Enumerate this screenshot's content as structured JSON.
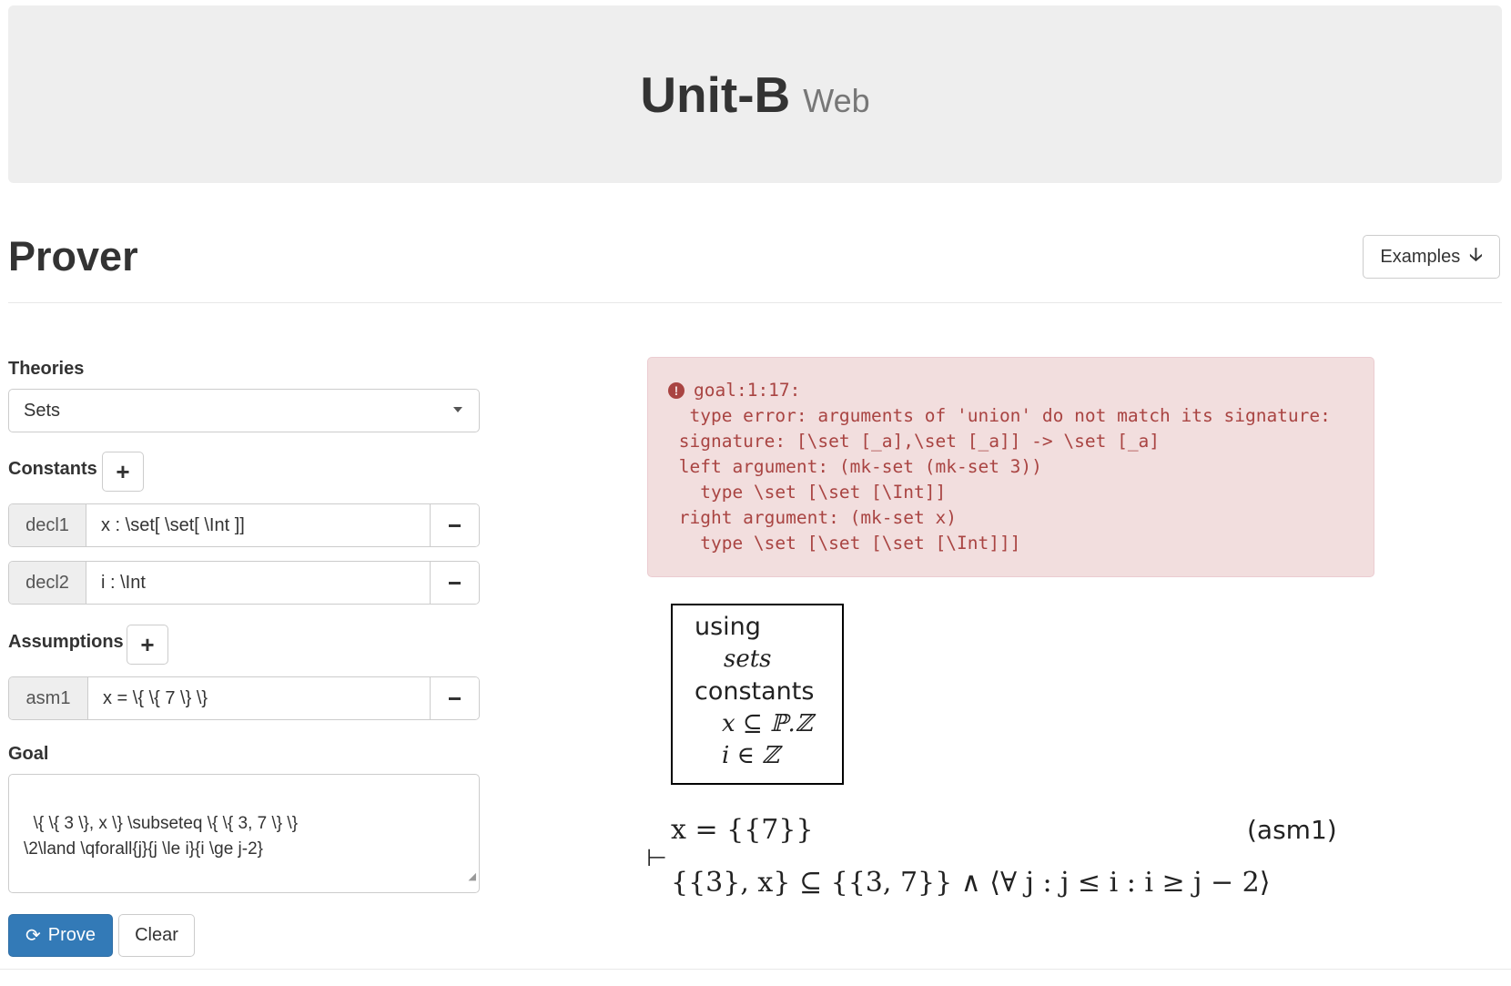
{
  "header": {
    "brand_main": "Unit-B",
    "brand_sub": "Web"
  },
  "page": {
    "title": "Prover",
    "examples_label": "Examples"
  },
  "form": {
    "theories_label": "Theories",
    "theory_selected": "Sets",
    "constants_label": "Constants",
    "constants": [
      {
        "name": "decl1",
        "value": "x : \\set[ \\set[ \\Int ]]"
      },
      {
        "name": "decl2",
        "value": "i : \\Int"
      }
    ],
    "assumptions_label": "Assumptions",
    "assumptions": [
      {
        "name": "asm1",
        "value": "x = \\{ \\{ 7 \\} \\}"
      }
    ],
    "goal_label": "Goal",
    "goal_text": "\\{ \\{ 3 \\}, x \\} \\subseteq \\{ \\{ 3, 7 \\} \\}\n\\2\\land \\qforall{j}{j \\le i}{i \\ge j-2}",
    "prove_label": "Prove",
    "clear_label": "Clear"
  },
  "error": {
    "lines": [
      "goal:1:17:",
      "  type error: arguments of 'union' do not match its signature:",
      " signature: [\\set [_a],\\set [_a]] -> \\set [_a]",
      " left argument: (mk-set (mk-set 3))",
      "   type \\set [\\set [\\Int]]",
      " right argument: (mk-set x)",
      "   type \\set [\\set [\\set [\\Int]]]"
    ]
  },
  "rendered": {
    "using_kw": "using",
    "theory_name": "sets",
    "constants_kw": "constants",
    "const1": "x ⊆ ℙ.ℤ",
    "const2": "i ∈ ℤ",
    "assumption_formula": "x = {{7}}",
    "assumption_tag": "(asm1)",
    "turnstile": "⊢",
    "goal_formula": "{{3}, x} ⊆ {{3, 7}}   ∧   ⟨∀ j : j ≤ i : i ≥ j − 2⟩"
  },
  "colors": {
    "jumbotron_bg": "#eeeeee",
    "primary": "#337ab7",
    "error_bg": "#f2dede",
    "error_text": "#a94442"
  },
  "icons": {
    "examples": "arrow-down-icon",
    "add": "plus-icon",
    "remove": "minus-icon",
    "prove": "refresh-icon",
    "error": "exclamation-circle-icon",
    "select": "caret-down-icon"
  }
}
